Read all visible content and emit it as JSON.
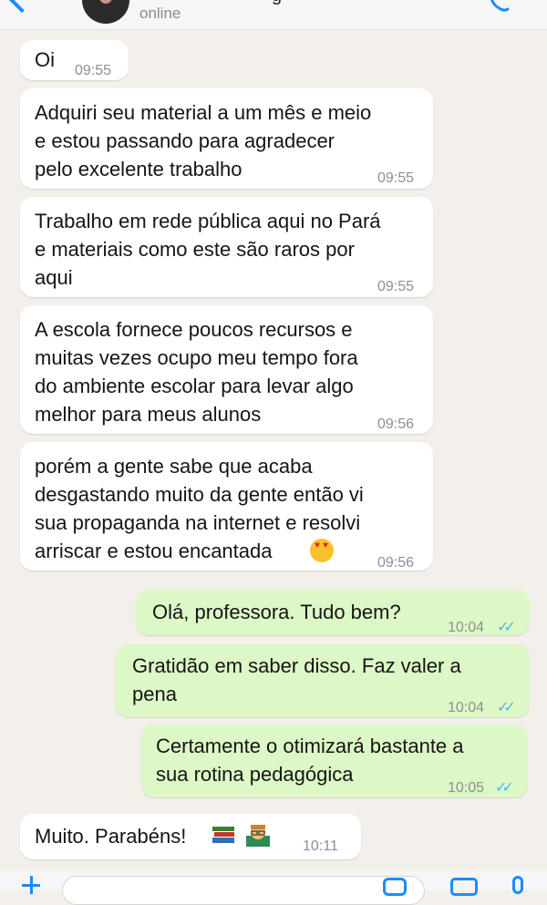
{
  "header": {
    "status": "online",
    "name_fragment": "g"
  },
  "messages": [
    {
      "direction": "in",
      "text": "Oi",
      "time": "09:55"
    },
    {
      "direction": "in",
      "text": "Adquiri seu material a um mês e meio\ne estou passando para agradecer\npelo excelente trabalho",
      "time": "09:55"
    },
    {
      "direction": "in",
      "text": "Trabalho em rede pública aqui no Pará\ne materiais como este são raros por\naqui",
      "time": "09:55"
    },
    {
      "direction": "in",
      "text": "A escola fornece poucos recursos e\nmuitas vezes ocupo meu tempo fora\ndo ambiente escolar para levar algo\nmelhor para meus alunos",
      "time": "09:56"
    },
    {
      "direction": "in",
      "text": "porém a gente sabe que acaba\ndesgastando muito da gente então vi\nsua propaganda na internet e resolvi\narriscar e estou encantada",
      "time": "09:56",
      "emoji": "smiling-face-with-heart-eyes"
    },
    {
      "direction": "out",
      "text": "Olá, professora. Tudo bem?",
      "time": "10:04",
      "read": true
    },
    {
      "direction": "out",
      "text": "Gratidão em saber disso. Faz valer a\npena",
      "time": "10:04",
      "read": true
    },
    {
      "direction": "out",
      "text": "Certamente o otimizará bastante a\nsua rotina pedagógica",
      "time": "10:05",
      "read": true
    },
    {
      "direction": "in",
      "text": "Muito. Parabéns!",
      "time": "10:11",
      "emoji": "books-and-teacher"
    }
  ],
  "ticks": "✓✓",
  "colors": {
    "background": "#f3efea",
    "incoming_bubble": "#ffffff",
    "outgoing_bubble": "#dcf8c6",
    "accent": "#1a8cff",
    "read_ticks": "#4fb6ec"
  },
  "icons": [
    "back-chevron-icon",
    "avatar",
    "phone-icon",
    "plus-icon",
    "sticker-icon",
    "camera-icon",
    "mic-icon"
  ]
}
